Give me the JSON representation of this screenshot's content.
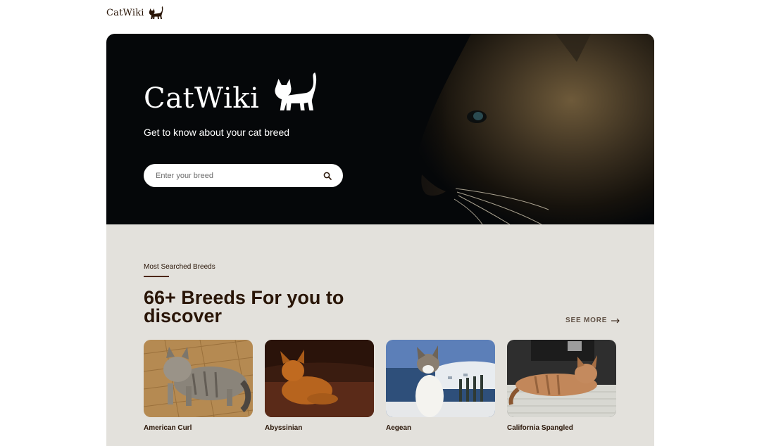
{
  "header": {
    "brand": "CatWiki",
    "logo_icon": "cat-icon"
  },
  "hero": {
    "brand": "CatWiki",
    "tagline": "Get to know about your cat breed",
    "search": {
      "placeholder": "Enter your breed",
      "value": "",
      "icon": "search-icon"
    }
  },
  "breeds_section": {
    "label": "Most Searched Breeds",
    "headline": "66+ Breeds For you to discover",
    "see_more": "SEE MORE",
    "cards": [
      {
        "name": "American Curl"
      },
      {
        "name": "Abyssinian"
      },
      {
        "name": "Aegean"
      },
      {
        "name": "California Spangled"
      }
    ]
  },
  "colors": {
    "text_dark": "#291507",
    "hero_bg": "#050709",
    "section_bg": "#e3e1dc",
    "accent_rule": "#4d270c"
  }
}
